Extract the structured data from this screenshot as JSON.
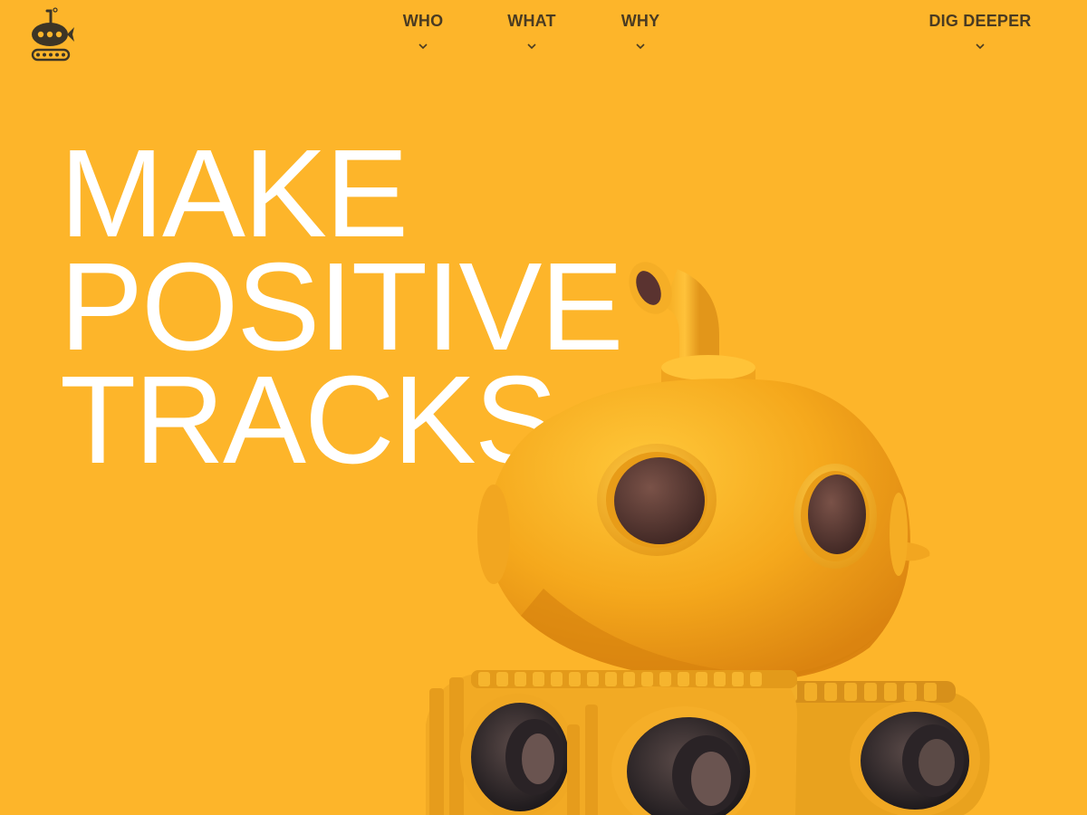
{
  "brand": {
    "logo_icon": "submarine-tank-logo-icon",
    "background_color": "#FDB52A",
    "text_color": "#4A3B22"
  },
  "nav": {
    "items": [
      {
        "label": "WHO",
        "icon": "chevron-down-icon"
      },
      {
        "label": "WHAT",
        "icon": "chevron-down-icon"
      },
      {
        "label": "WHY",
        "icon": "chevron-down-icon"
      },
      {
        "label": "DIG DEEPER",
        "icon": "chevron-down-icon"
      }
    ]
  },
  "hero": {
    "headline_lines": [
      "MAKE",
      "POSITIVE",
      "TRACKS"
    ],
    "headline_color": "#FFFFFF",
    "illustration": "yellow-submarine-tank-illustration"
  }
}
